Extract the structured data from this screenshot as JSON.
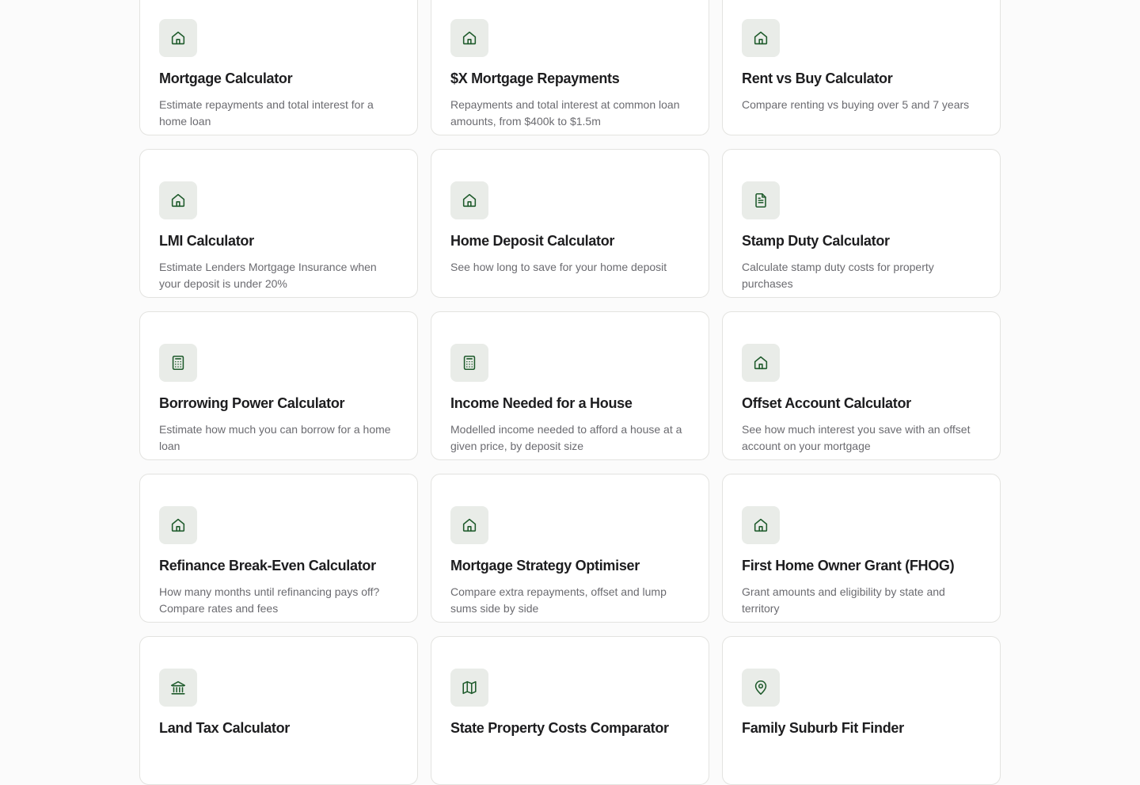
{
  "cards": [
    {
      "icon": "home-icon",
      "title": "Mortgage Calculator",
      "desc": "Estimate repayments and total interest for a home loan"
    },
    {
      "icon": "home-icon",
      "title": "$X Mortgage Repayments",
      "desc": "Repayments and total interest at common loan amounts, from $400k to $1.5m"
    },
    {
      "icon": "home-icon",
      "title": "Rent vs Buy Calculator",
      "desc": "Compare renting vs buying over 5 and 7 years"
    },
    {
      "icon": "home-icon",
      "title": "LMI Calculator",
      "desc": "Estimate Lenders Mortgage Insurance when your deposit is under 20%"
    },
    {
      "icon": "home-icon",
      "title": "Home Deposit Calculator",
      "desc": "See how long to save for your home deposit"
    },
    {
      "icon": "document-icon",
      "title": "Stamp Duty Calculator",
      "desc": "Calculate stamp duty costs for property purchases"
    },
    {
      "icon": "calculator-icon",
      "title": "Borrowing Power Calculator",
      "desc": "Estimate how much you can borrow for a home loan"
    },
    {
      "icon": "calculator-icon",
      "title": "Income Needed for a House",
      "desc": "Modelled income needed to afford a house at a given price, by deposit size"
    },
    {
      "icon": "home-icon",
      "title": "Offset Account Calculator",
      "desc": "See how much interest you save with an offset account on your mortgage"
    },
    {
      "icon": "home-icon",
      "title": "Refinance Break-Even Calculator",
      "desc": "How many months until refinancing pays off? Compare rates and fees"
    },
    {
      "icon": "home-icon",
      "title": "Mortgage Strategy Optimiser",
      "desc": "Compare extra repayments, offset and lump sums side by side"
    },
    {
      "icon": "home-icon",
      "title": "First Home Owner Grant (FHOG)",
      "desc": "Grant amounts and eligibility by state and territory"
    },
    {
      "icon": "bank-icon",
      "title": "Land Tax Calculator",
      "desc": ""
    },
    {
      "icon": "map-icon",
      "title": "State Property Costs Comparator",
      "desc": ""
    },
    {
      "icon": "map-pin-icon",
      "title": "Family Suburb Fit Finder",
      "desc": ""
    }
  ],
  "colors": {
    "accent": "#1f5b2c",
    "icon_bg": "#e9ece8",
    "border": "#e3e3e0"
  }
}
